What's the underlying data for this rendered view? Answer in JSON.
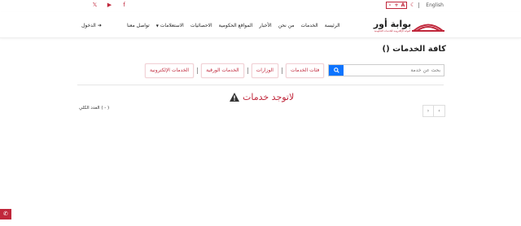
{
  "topbar": {
    "social": [
      {
        "icon": "x-twitter-icon",
        "glyph": "𝕏"
      },
      {
        "icon": "youtube-icon",
        "glyph": "▶"
      },
      {
        "icon": "facebook-icon",
        "glyph": "f"
      }
    ],
    "font_controls": [
      "A",
      "+",
      "-"
    ],
    "theme_icon": "moon-icon",
    "language": "English"
  },
  "header": {
    "logo_text": "بوابة أور",
    "logo_sub": "البوابة الإلكترونية للخدمات الحكومية",
    "nav": [
      "الرئيسة",
      "الخدمات",
      "من نحن",
      "الأخبار",
      "المواقع الحكومية",
      "الاحصائيات",
      "الاستعلامات",
      "تواصل معنا"
    ],
    "nav_dropdown_index": 6,
    "login_label": "الدخول"
  },
  "main": {
    "title": "كافة الخدمات ()",
    "search": {
      "placeholder": "بحث عن خدمة"
    },
    "filters": [
      "فئات الخدمات",
      "الوزارات",
      "الخدمات الورقية",
      "الخدمات الإلكترونية"
    ],
    "empty_message": "لاتوجد خدمات",
    "count_label": "( - ) العدد الكلي",
    "pager": {
      "prev": "‹",
      "next": "›"
    }
  },
  "colors": {
    "accent": "#c0273b",
    "search_button": "#0d74ff"
  }
}
